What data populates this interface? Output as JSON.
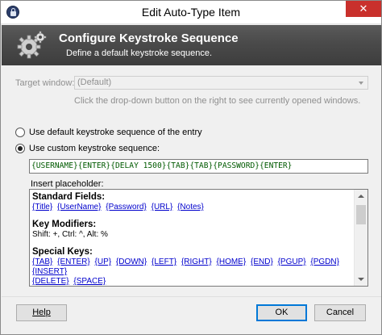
{
  "window": {
    "title": "Edit Auto-Type Item",
    "close_glyph": "✕"
  },
  "banner": {
    "title": "Configure Keystroke Sequence",
    "subtitle": "Define a default keystroke sequence.",
    "icon": "gears-icon"
  },
  "target": {
    "label": "Target window:",
    "value": "(Default)",
    "hint": "Click the drop-down button on the right to see currently opened windows."
  },
  "radios": {
    "default_label": "Use default keystroke sequence of the entry",
    "default_checked": false,
    "custom_label": "Use custom keystroke sequence:",
    "custom_checked": true
  },
  "sequence": {
    "value": "{USERNAME}{ENTER}{DELAY 1500}{TAB}{TAB}{PASSWORD}{ENTER}"
  },
  "placeholders": {
    "label": "Insert placeholder:",
    "standard_heading": "Standard Fields:",
    "standard_fields": [
      "{Title}",
      "{UserName}",
      "{Password}",
      "{URL}",
      "{Notes}"
    ],
    "modifiers_heading": "Key Modifiers:",
    "modifiers_text": "Shift: +, Ctrl: ^, Alt: %",
    "special_heading": "Special Keys:",
    "special_keys_row1": [
      "{TAB}",
      "{ENTER}",
      "{UP}",
      "{DOWN}",
      "{LEFT}",
      "{RIGHT}",
      "{HOME}",
      "{END}",
      "{PGUP}",
      "{PGDN}",
      "{INSERT}"
    ],
    "special_keys_row2": [
      "{DELETE}",
      "{SPACE}"
    ]
  },
  "buttons": {
    "help": "Help",
    "ok": "OK",
    "cancel": "Cancel"
  },
  "colors": {
    "banner": "#4a4a4a",
    "sequence_text": "#005a00",
    "link": "#0000cc",
    "close": "#c9302c",
    "default_button_border": "#0078d7"
  }
}
